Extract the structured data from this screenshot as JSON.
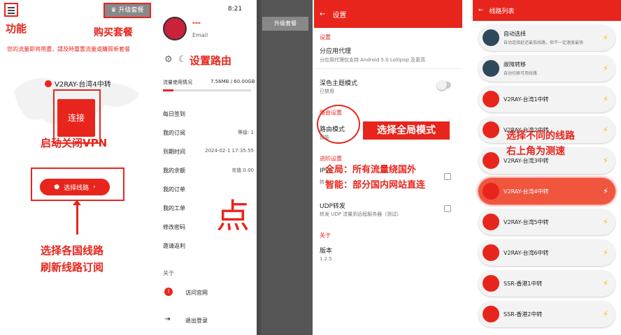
{
  "panel1": {
    "menu_icon": "hamburger-icon",
    "upgrade_label": "升级套餐",
    "traffic_msg": "您的流量即将用盡，請及時重置流量或購買新套餐",
    "current_line": "V2RAY-台湾4中转",
    "connect_label": "连接",
    "select_line_label": "选择线路",
    "ann_function": "功能",
    "ann_buy": "购买套餐",
    "ann_vpn": "启动关闭VPN",
    "ann_select_1": "选择各国线路",
    "ann_select_2": "刷新线路订阅"
  },
  "panel2": {
    "time": "8:21",
    "user_name": "***",
    "email": "Email",
    "usage_label": "流量使用情况",
    "usage_value": "7.56MB / 60.00GB",
    "usage_fraction": 0.12,
    "menu": [
      {
        "label": "每日签到",
        "value": ""
      },
      {
        "label": "我的订阅",
        "value": "等级: 1"
      },
      {
        "label": "到期时间",
        "value": "2024-02-1 17:35:55"
      },
      {
        "label": "我的余额",
        "value": "充值 0.00"
      },
      {
        "label": "我的订单",
        "value": ""
      },
      {
        "label": "我的工单",
        "value": ""
      },
      {
        "label": "修改密码",
        "value": ""
      },
      {
        "label": "邀请返利",
        "value": ""
      }
    ],
    "about": "关于",
    "visit_site": "访问官网",
    "logout": "退出登录",
    "upgrade_label": "升级套餐",
    "ann_route": "设置路由",
    "ann_click": "点"
  },
  "panel3": {
    "title": "设置",
    "sec_settings": "设置",
    "split_title": "分应用代理",
    "split_sub": "分应用代理仅支持 Android 5.0 Lollipop 及更高",
    "dark_title": "深色主题模式",
    "dark_sub": "已禁用",
    "sec_route": "路由设置",
    "route_title": "路由模式",
    "route_sub": "智能",
    "sec_adv": "进阶设置",
    "ipv6_title": "IPv6",
    "ipv6_sub": "转",
    "udp_title": "UDP转发",
    "udp_sub": "转发 UDP 流量到远程服务器（测试）",
    "sec_about": "关于",
    "version_title": "版本",
    "version_value": "1.2.5",
    "ann_global": "选择全局模式",
    "ann_g1": "全局：所有流量绕国外",
    "ann_g2": "智能：部分国内网站直连"
  },
  "panel4": {
    "title": "线路列表",
    "items": [
      {
        "name": "自动选择",
        "sub": "自动连接延迟最低线路，但不一定速度最快"
      },
      {
        "name": "故障转移",
        "sub": "自动切换可用线路"
      },
      {
        "name": "V2RAY-台湾1中转",
        "sub": ""
      },
      {
        "name": "V2RAY-台湾2中转",
        "sub": ""
      },
      {
        "name": "V2RAY-台湾3中转",
        "sub": ""
      },
      {
        "name": "V2RAY-台湾4中转",
        "sub": ""
      },
      {
        "name": "V2RAY-台湾5中转",
        "sub": ""
      },
      {
        "name": "V2RAY-台湾6中转",
        "sub": ""
      },
      {
        "name": "SSR-香港1中转",
        "sub": ""
      },
      {
        "name": "SSR-香港2中转",
        "sub": ""
      }
    ],
    "ann_1": "选择不同的线路",
    "ann_2": "右上角为测速"
  },
  "colors": {
    "accent": "#e8251c"
  }
}
